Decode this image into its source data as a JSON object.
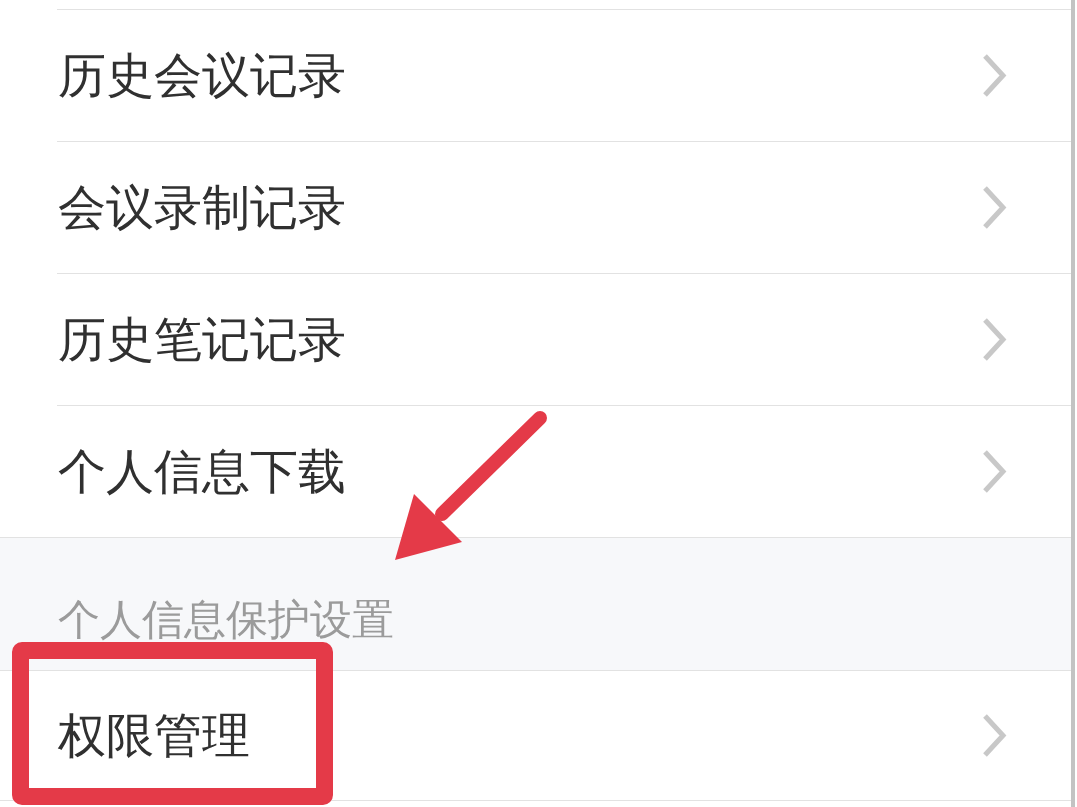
{
  "sections": [
    {
      "items": [
        {
          "label": "历史会议记录",
          "highlighted": false
        },
        {
          "label": "会议录制记录",
          "highlighted": false
        },
        {
          "label": "历史笔记记录",
          "highlighted": false
        },
        {
          "label": "个人信息下载",
          "highlighted": false
        }
      ]
    },
    {
      "title": "个人信息保护设置",
      "items": [
        {
          "label": "权限管理",
          "highlighted": true
        }
      ]
    }
  ]
}
